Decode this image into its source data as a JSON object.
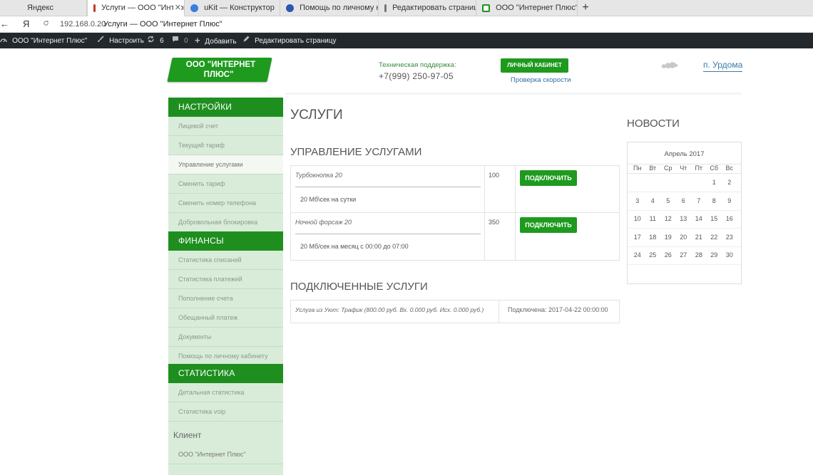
{
  "browser": {
    "tabs": [
      {
        "title": "Яндекс",
        "icon": "yandex-icon",
        "active": false
      },
      {
        "title": "Услуги — ООО \"Интернет",
        "icon": "page-icon",
        "active": true
      },
      {
        "title": "uKit — Конструктор",
        "icon": "ukit-icon",
        "active": false
      },
      {
        "title": "Помощь по личному кабин",
        "icon": "help-icon",
        "active": false
      },
      {
        "title": "Редактировать страницу ‹ С",
        "icon": "page-icon",
        "active": false
      },
      {
        "title": "ООО \"Интернет Плюс\"-Сап",
        "icon": "site-icon",
        "active": false
      }
    ],
    "close_glyph": "✕",
    "new_tab_glyph": "+",
    "back_glyph": "←",
    "yandex_glyph": "Я",
    "url": "192.168.0.20",
    "page_title": "Услуги — ООО \"Интернет Плюс\""
  },
  "adminbar": {
    "site_name": "ООО \"Интернет Плюс\"",
    "customize": "Настроить",
    "updates_count": "6",
    "comments_count": "0",
    "add_new": "Добавить",
    "edit_page": "Редактировать страницу"
  },
  "header": {
    "logo_line1": "ООО \"ИНТЕРНЕТ",
    "logo_line2": "ПЛЮС\"",
    "support_label": "Техническая поддержка:",
    "support_phone": "+7(999) 250-97-05",
    "cabinet_button": "ЛИЧНЫЙ КАБИНЕТ",
    "speed_test": "Проверка скорости",
    "city": "п. Урдома"
  },
  "sidebar": {
    "settings_title": "НАСТРОЙКИ",
    "settings_items": [
      "Лицевой счет",
      "Текущий тариф",
      "Управление услугами",
      "Сменить тариф",
      "Сменить номер телефона",
      "Добровольная блокировка"
    ],
    "finance_title": "ФИНАНСЫ",
    "finance_items": [
      "Статистика списаний",
      "Статистика платежей",
      "Пополнение счета",
      "Обещанный платеж",
      "Документы",
      "Помощь по личному кабинету"
    ],
    "stats_title": "СТАТИСТИКА",
    "stats_items": [
      "Детальная статистика",
      "Статистика voip"
    ],
    "client_label": "Клиент",
    "client_name": "ООО \"Интернет Плюс\""
  },
  "main": {
    "page_title": "УСЛУГИ",
    "manage_title": "УПРАВЛЕНИЕ УСЛУГАМИ",
    "services": [
      {
        "name": "Турбокнопка 20",
        "price": "100",
        "description": "20 Мб\\сек на сутки",
        "button": "ПОДКЛЮЧИТЬ"
      },
      {
        "name": "Ночной форсаж 20",
        "price": "350",
        "description": "20 Мб/сек на месяц с 00:00 до 07:00",
        "button": "ПОДКЛЮЧИТЬ"
      }
    ],
    "connected_title": "ПОДКЛЮЧЕННЫЕ УСЛУГИ",
    "connected": {
      "service": "Услуга из Уют: Трафик (800.00 руб. Вх. 0.000 руб. Исх. 0.000 руб.)",
      "status": "Подключена: 2017-04-22 00:00:00"
    }
  },
  "news": {
    "title": "НОВОСТИ",
    "calendar_caption": "Апрель 2017",
    "weekdays": [
      "Пн",
      "Вт",
      "Ср",
      "Чт",
      "Пт",
      "Сб",
      "Вс"
    ],
    "weeks": [
      [
        "",
        "",
        "",
        "",
        "",
        "1",
        "2"
      ],
      [
        "3",
        "4",
        "5",
        "6",
        "7",
        "8",
        "9"
      ],
      [
        "10",
        "11",
        "12",
        "13",
        "14",
        "15",
        "16"
      ],
      [
        "17",
        "18",
        "19",
        "20",
        "21",
        "22",
        "23"
      ],
      [
        "24",
        "25",
        "26",
        "27",
        "28",
        "29",
        "30"
      ]
    ]
  },
  "colors": {
    "brand_green": "#1e9a1e",
    "sidebar_bg": "#d9ecd9",
    "adminbar_bg": "#23282d"
  }
}
